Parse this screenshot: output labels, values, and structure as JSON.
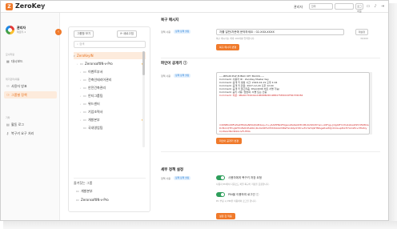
{
  "app": {
    "brand": "ZeroKey",
    "logo_letter": "Z",
    "accent": "#f07a2b"
  },
  "topbar": {
    "admin_label": "관리자",
    "lang_select": "한국",
    "input_placeholder": "",
    "small_btn": "로그아웃",
    "icons": [
      "monitor-icon",
      "bell-icon",
      "logout-icon"
    ]
  },
  "sidebar": {
    "user_name": "관리자",
    "user_sub": "제로키-1",
    "sections": [
      {
        "title": "모니터링",
        "items": [
          {
            "label": "대시보드",
            "icon": "grid-icon",
            "active": false
          }
        ]
      },
      {
        "title": "위기관리/대응",
        "items": [
          {
            "label": "사용자 방표",
            "icon": "users-icon",
            "active": false
          },
          {
            "label": "그룹별 정책",
            "icon": "group-icon",
            "active": true
          }
        ]
      },
      {
        "title": "기타",
        "items": [
          {
            "label": "활동 로그",
            "icon": "doc-icon",
            "active": false
          },
          {
            "label": "복구키 요구 처리",
            "icon": "key-icon",
            "active": false
          }
        ]
      }
    ]
  },
  "tree": {
    "add_btn": "그룹함 보기",
    "refresh_btn": "새로고침",
    "search_placeholder": "검색",
    "items": [
      {
        "label": "ZeroKeyIN",
        "level": 0,
        "selected": true,
        "star": false
      },
      {
        "label": "ZeronsoftIN-v-Pro",
        "level": 1,
        "selected": false,
        "star": true
      },
      {
        "label": "이벤트부서",
        "level": 2,
        "selected": false,
        "star": false
      },
      {
        "label": "건축인테리어관리",
        "level": 2,
        "selected": false,
        "star": false
      },
      {
        "label": "안전건축관리",
        "level": 2,
        "selected": false,
        "star": false
      },
      {
        "label": "안티그룹팀",
        "level": 2,
        "selected": false,
        "star": false
      },
      {
        "label": "위드센터",
        "level": 2,
        "selected": false,
        "star": false
      },
      {
        "label": "기업조력사",
        "level": 2,
        "selected": false,
        "star": false
      },
      {
        "label": "개발본부",
        "level": 2,
        "selected": false,
        "star": true
      },
      {
        "label": "국내영업팀",
        "level": 2,
        "selected": false,
        "star": false
      }
    ],
    "favorites_title": "즐겨찾는 그룹",
    "favorites": [
      {
        "label": "개발본부"
      },
      {
        "label": "ZeronsoftIN-v-Pro"
      }
    ]
  },
  "recovery": {
    "title": "복구 메시지",
    "label": "정책 사용",
    "badge": "정책 정책 설정",
    "value": "자를 일반/자문에 문의하세요 : 02-XXX-XXXX",
    "reset_btn": "재설정",
    "help": "복구 메시지는 최대 100자를 입력합니다.",
    "count": "39/100",
    "apply_btn": "복구 메시지 변경"
  },
  "pgp": {
    "title": "파인어 공개키 ⓘ",
    "label": "정책 사용",
    "badge": "정책 정책 설정",
    "header": "-----BEGIN PGP PUBLIC KEY BLOCK-----",
    "lines": [
      "Comment: 사용자 ID : ZeroKey Master Key",
      "Comment: 공개 키 생성 시간: 2024-04-19 오후 4:04",
      "Comment: 공개 키 만료: 2027-12-20 오후 12:00",
      "Comment: 공개 키 알고리즘: RSA(4096 비트 서명 가능)",
      "Comment: 공키 사용: 암호화, 서명 또는 인증",
      "Comment: 지문: 4BA6C7D4C6A21B08IB2DC4B8475ED0C6F84376D84"
    ],
    "blob": "mQINBGKRFLWe2fMA6eNMAQIAB4aq+3+y4AMPNkZf4gsoa8a6a0Z3hdBv6xSNrWYwo+k6Fgg-J/4g4iEYmtG4aSwWZVd5R8UeDcBx1QTEngWHmEstlCEa6K1/Rv0xX6FAIYPdXbbGDhBsFGCZApSTZrvsFsYGHq9HfRAgeRvIZ0Jr2rkGuqZkkH7AmZtcvdTkZzyC/x8aG3NmN9GUvFLHMA",
    "apply_btn": "파인어 공개키 변경"
  },
  "security": {
    "title": "세부 정책 설정",
    "label": "정책 사용",
    "badge": "정책 정책 설정",
    "toggle1_label": "사용자에게 복구키 저장 요청",
    "toggle1_sub": "사용자 PC에서 다운로드 파일 복구키 저장을 요청합니다.",
    "toggle1_on": true,
    "toggle2_label": "PIN을 이용하여 로그인 ⓘ",
    "toggle2_sub": "PC 부팅 시 PIN을 이용하여 로그인 합니다.",
    "toggle2_on": true,
    "apply_btn": "설정 값 적용"
  }
}
